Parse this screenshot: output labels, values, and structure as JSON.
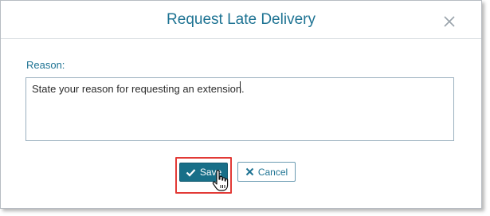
{
  "dialog": {
    "title": "Request Late Delivery",
    "reason_label": "Reason:",
    "reason_value": "State your reason for requesting an extension.",
    "save_label": "Save",
    "cancel_label": "Cancel"
  },
  "icons": {
    "close": "close-icon",
    "save": "check-icon",
    "cancel": "x-icon",
    "pointer": "hand-pointer-cursor"
  },
  "colors": {
    "accent": "#1e7393",
    "save_button": "#186f88",
    "highlight": "#e23a36"
  }
}
